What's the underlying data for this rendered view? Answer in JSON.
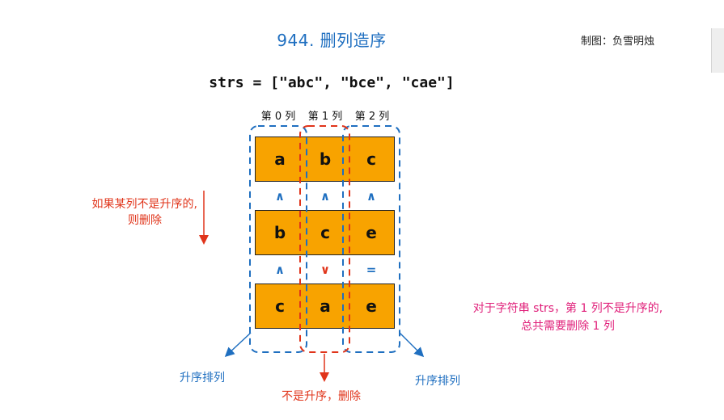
{
  "title": "944. 删列造序",
  "author": "制图：负雪明烛",
  "strs_line": "strs = [\"abc\", \"bce\", \"cae\"]",
  "columns": [
    "第 0 列",
    "第 1 列",
    "第 2 列"
  ],
  "rows": [
    [
      "a",
      "b",
      "c"
    ],
    [
      "b",
      "c",
      "e"
    ],
    [
      "c",
      "a",
      "e"
    ]
  ],
  "comparisons": [
    [
      "∧",
      "∧",
      "∧"
    ],
    [
      "∧",
      "∨",
      "="
    ]
  ],
  "left_note": {
    "line1": "如果某列不是升序的,",
    "line2": "则删除"
  },
  "label_left": "升序排列",
  "label_right": "升序排列",
  "label_bottom": "不是升序，删除",
  "right_note": {
    "line1": "对于字符串 strs，第 1 列不是升序的,",
    "line2": "总共需要删除 1 列"
  },
  "colors": {
    "blue": "#1f6fc0",
    "red": "#e0341a",
    "magenta": "#e0207a",
    "cell_fill": "#f8a300"
  }
}
